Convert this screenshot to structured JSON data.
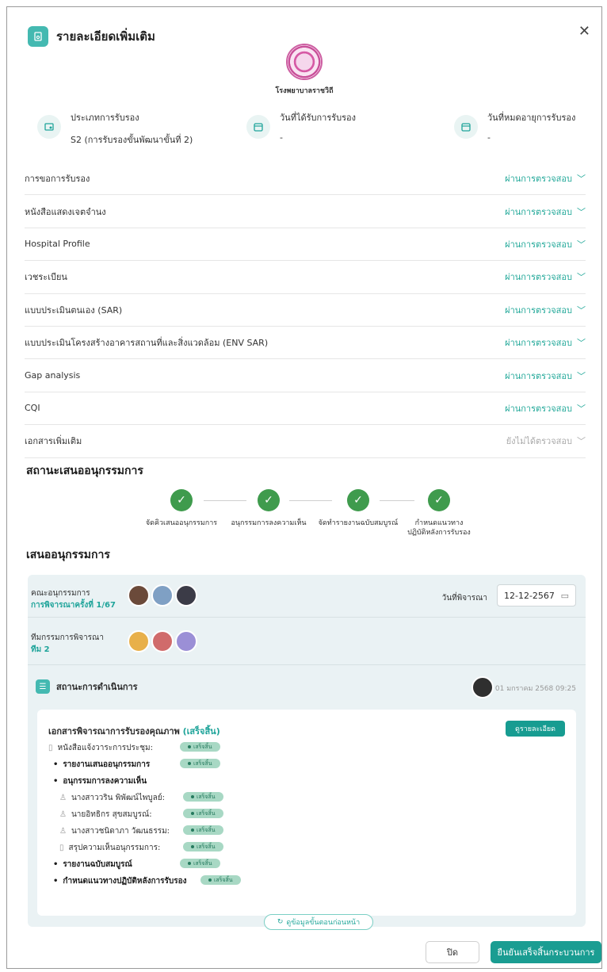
{
  "dialog": {
    "title": "รายละเอียดเพิ่มเติม"
  },
  "hospital": {
    "name": "โรงพยาบาลราชวิถี"
  },
  "info": [
    {
      "label": "ประเภทการรับรอง",
      "value": "S2 (การรับรองขั้นพัฒนาขั้นที่ 2)"
    },
    {
      "label": "วันที่ได้รับการรับรอง",
      "value": "-"
    },
    {
      "label": "วันที่หมดอายุการรับรอง",
      "value": "-"
    }
  ],
  "documents": [
    {
      "name": "การขอการรับรอง",
      "status": "ผ่านการตรวจสอบ"
    },
    {
      "name": "หนังสือแสดงเจตจำนง",
      "status": "ผ่านการตรวจสอบ"
    },
    {
      "name": "Hospital Profile",
      "status": "ผ่านการตรวจสอบ"
    },
    {
      "name": "เวชระเบียน",
      "status": "ผ่านการตรวจสอบ"
    },
    {
      "name": "แบบประเมินตนเอง (SAR)",
      "status": "ผ่านการตรวจสอบ"
    },
    {
      "name": "แบบประเมินโครงสร้างอาคารสถานที่และสิ่งแวดล้อม (ENV SAR)",
      "status": "ผ่านการตรวจสอบ"
    },
    {
      "name": "Gap analysis",
      "status": "ผ่านการตรวจสอบ"
    },
    {
      "name": "CQI",
      "status": "ผ่านการตรวจสอบ"
    },
    {
      "name": "เอกสารเพิ่มเติม",
      "status": "ยังไม่ได้ตรวจสอบ"
    }
  ],
  "status_section": {
    "title": "สถานะเสนออนุกรรมการ",
    "steps": [
      {
        "label": "จัดคิวเสนออนุกรรมการ"
      },
      {
        "label": "อนุกรรมการลงความเห็น"
      },
      {
        "label": "จัดทำรายงานฉบับสมบูรณ์"
      },
      {
        "label": "กำหนดแนวทาง",
        "label2": "ปฏิบัติหลังการรับรอง"
      }
    ]
  },
  "committee": {
    "title": "เสนออนุกรรมการ",
    "board_label": "คณะอนุกรรมการ",
    "board_link": "การพิจารณาครั้งที่ 1/67",
    "date_label": "วันที่พิจารณา",
    "date_value": "12-12-2567",
    "team_label": "ทีมกรรมการพิจารณา",
    "team_link": "ทีม 2",
    "progress_label": "สถานะการดำเนินการ",
    "progress_time": "01 มกราคม 2568 09:25"
  },
  "card": {
    "title": "เอกสารพิจารณาการรับรองคุณภาพ",
    "title_status": "(เสร็จสิ้น)",
    "detail_button": "ดูรายละเอียด",
    "badge": "เสร็จสิ้น",
    "items": [
      {
        "label": "หนังสือแจ้งวาระการประชุม:"
      },
      {
        "label": "รายงานเสนออนุกรรมการ"
      },
      {
        "label": "อนุกรรมการลงความเห็น"
      },
      {
        "label": "นางสาววริน พิพัฒน์ไพบูลย์:"
      },
      {
        "label": "นายอิทธิกร สุขสมบูรณ์:"
      },
      {
        "label": "นางสาวชนิดาภา วัฒนธรรม:"
      },
      {
        "label": "สรุปความเห็นอนุกรรมการ:"
      },
      {
        "label": "รายงานฉบับสมบูรณ์"
      },
      {
        "label": "กำหนดแนวทางปฏิบัติหลังการรับรอง"
      }
    ]
  },
  "prev_button": "ดูข้อมูลขั้นตอนก่อนหน้า",
  "footer": {
    "close": "ปิด",
    "confirm": "ยืนยันเสร็จสิ้นกระบวนการ"
  },
  "colors": {
    "accent": "#1a9d92",
    "success": "#3f9b4d",
    "panel": "#eaf2f4"
  }
}
